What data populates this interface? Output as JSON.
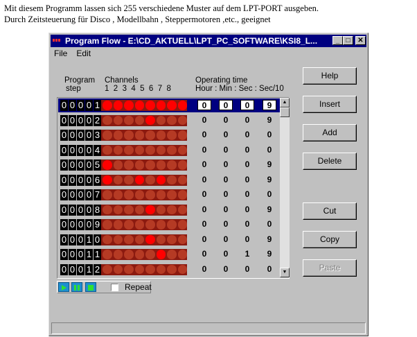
{
  "intro": {
    "line1": "Mit diesem Programm lassen sich 255 verschiedene Muster auf dem LPT-PORT ausgeben.",
    "line2": "Durch Zeitsteuerung für Disco , Modellbahn , Steppermotoren ,etc., geeignet"
  },
  "window": {
    "title": "Program Flow - E:\\CD_AKTUELL\\LPT_PC_SOFTWARE\\KSI8_L...",
    "minimize": "_",
    "maximize": "□",
    "close": "✕"
  },
  "menu": {
    "file": "File",
    "edit": "Edit"
  },
  "headers": {
    "program": "Program",
    "step": "step",
    "channels": "Channels",
    "channel_numbers": "1  2  3  4  5  6  7  8",
    "operating_time": "Operating time",
    "time_units": "Hour : Min : Sec : Sec/10"
  },
  "rows": [
    {
      "step": "00001",
      "leds": [
        1,
        1,
        1,
        1,
        1,
        1,
        1,
        1
      ],
      "time": [
        "0",
        "0",
        "0",
        "9"
      ],
      "selected": true
    },
    {
      "step": "00002",
      "leds": [
        0,
        0,
        0,
        0,
        1,
        0,
        0,
        0
      ],
      "time": [
        "0",
        "0",
        "0",
        "9"
      ]
    },
    {
      "step": "00003",
      "leds": [
        0,
        0,
        0,
        0,
        0,
        0,
        0,
        0
      ],
      "time": [
        "0",
        "0",
        "0",
        "0"
      ]
    },
    {
      "step": "00004",
      "leds": [
        0,
        0,
        0,
        0,
        0,
        0,
        0,
        0
      ],
      "time": [
        "0",
        "0",
        "0",
        "0"
      ]
    },
    {
      "step": "00005",
      "leds": [
        1,
        0,
        0,
        0,
        0,
        0,
        0,
        0
      ],
      "time": [
        "0",
        "0",
        "0",
        "9"
      ]
    },
    {
      "step": "00006",
      "leds": [
        1,
        0,
        0,
        1,
        0,
        1,
        0,
        0
      ],
      "time": [
        "0",
        "0",
        "0",
        "9"
      ]
    },
    {
      "step": "00007",
      "leds": [
        0,
        0,
        0,
        0,
        0,
        0,
        0,
        0
      ],
      "time": [
        "0",
        "0",
        "0",
        "0"
      ]
    },
    {
      "step": "00008",
      "leds": [
        0,
        0,
        0,
        0,
        1,
        0,
        0,
        0
      ],
      "time": [
        "0",
        "0",
        "0",
        "9"
      ]
    },
    {
      "step": "00009",
      "leds": [
        0,
        0,
        0,
        0,
        0,
        0,
        0,
        0
      ],
      "time": [
        "0",
        "0",
        "0",
        "0"
      ]
    },
    {
      "step": "00010",
      "leds": [
        0,
        0,
        0,
        0,
        1,
        0,
        0,
        0
      ],
      "time": [
        "0",
        "0",
        "0",
        "9"
      ]
    },
    {
      "step": "00011",
      "leds": [
        0,
        0,
        0,
        0,
        0,
        1,
        0,
        0
      ],
      "time": [
        "0",
        "0",
        "1",
        "9"
      ]
    },
    {
      "step": "00012",
      "leds": [
        0,
        0,
        0,
        0,
        0,
        0,
        0,
        0
      ],
      "time": [
        "0",
        "0",
        "0",
        "0"
      ]
    }
  ],
  "buttons": {
    "help": "Help",
    "insert": "Insert",
    "add": "Add",
    "delete": "Delete",
    "cut": "Cut",
    "copy": "Copy",
    "paste": "Paste"
  },
  "player": {
    "repeat_label": "Repeat",
    "repeat_checked": false
  },
  "colors": {
    "title_bg": "#000080",
    "led_on": "#ff0000",
    "led_off": "#b53a24",
    "play_btn": "#1e8fcf"
  }
}
